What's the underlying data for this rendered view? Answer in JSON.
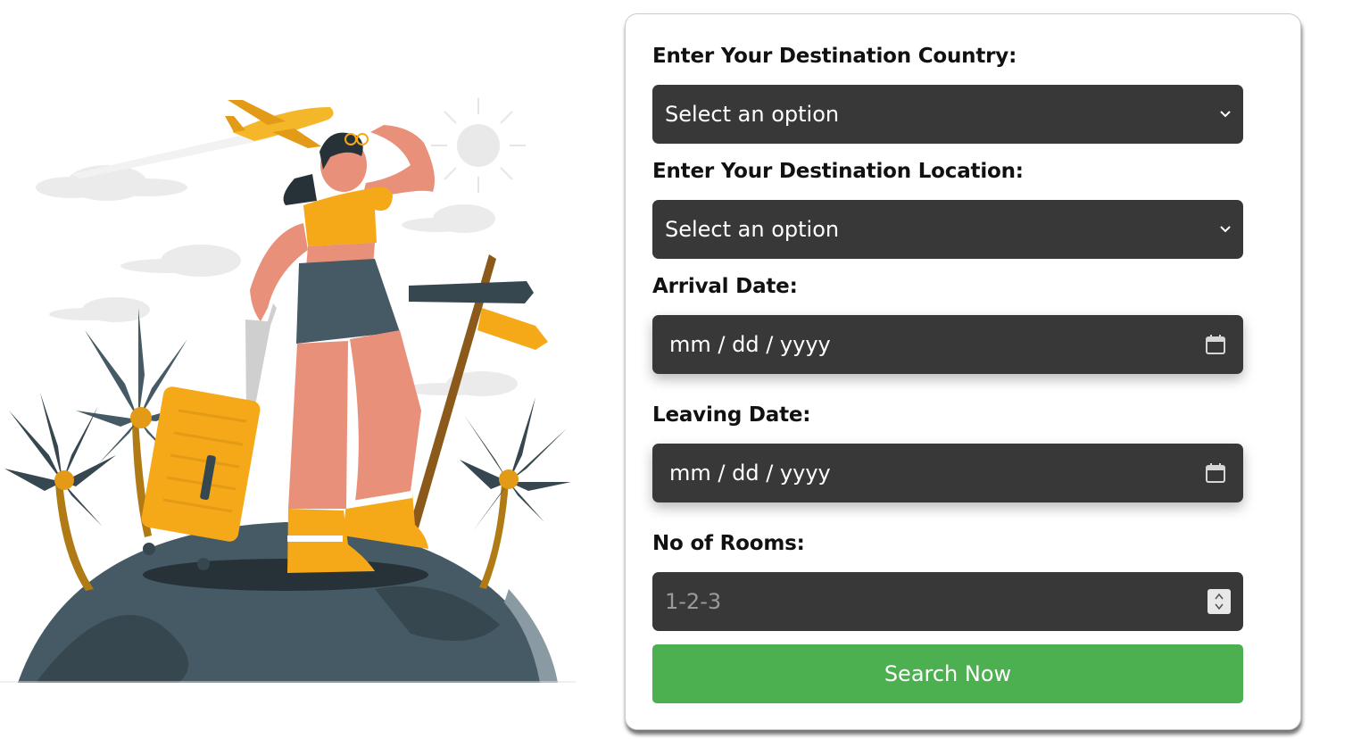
{
  "form": {
    "country_label": "Enter Your Destination Country:",
    "country_value": "Select an option",
    "location_label": "Enter Your Destination Location:",
    "location_value": "Select an option",
    "arrival_label": "Arrival Date:",
    "arrival_placeholder": "mm / dd / yyyy",
    "leaving_label": "Leaving Date:",
    "leaving_placeholder": "mm / dd / yyyy",
    "rooms_label": "No of Rooms:",
    "rooms_placeholder": "1-2-3",
    "search_label": "Search Now"
  },
  "icons": {
    "select_arrow": "chevron-down-icon",
    "date_picker": "calendar-icon",
    "number_stepper": "stepper-icon"
  },
  "colors": {
    "field_background": "#383838",
    "button_background": "#4caf50",
    "illustration_accent": "#f5a818",
    "illustration_dark": "#37474f",
    "illustration_skin": "#e89079"
  }
}
